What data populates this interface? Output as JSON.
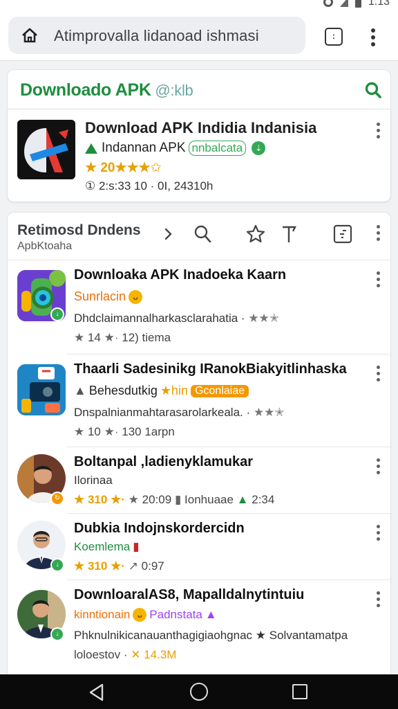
{
  "status": {
    "time": "1:13"
  },
  "browser": {
    "url": "Atimprovalla lidanoad ishmasi",
    "tabs_count": ":"
  },
  "search": {
    "title": "Downloado APK",
    "title_suffix": " @:klb"
  },
  "featured": {
    "title": "Download APK Indidia Indanisia",
    "developer": "Indannan APK",
    "developer_badge": "nnbalcata",
    "rating_text": "20",
    "stars": "★★★",
    "empty_star": "✩",
    "meta": "2:s:33 10 · 0I, 24310h"
  },
  "list": {
    "header_title": "Retimosd Dndens",
    "header_sub": "ApbKtoaha",
    "items": [
      {
        "title": "Downloaka APK Inadoeka Kaarn",
        "tag": "Sunrlacin",
        "tag_color": "#e8710a",
        "desc": "Dhdclaimannalharkasclarahatia ·",
        "desc_stars": "★★✭",
        "rating": "14",
        "meta": "12) tiema"
      },
      {
        "title": "Thaarli Sadesinikg IRanokBiakyitlinhaska",
        "tag": "Behesdutkig",
        "tag_extra": "★hin",
        "tag_pill": "Gconlaiae",
        "desc": "Dnspalnianmahtarasarolarkeala. ·",
        "desc_stars": "★★✭",
        "rating": "10",
        "meta": "130 1arpn"
      },
      {
        "title": "Boltanpal ,ladienyklamukar",
        "tag": "Ilorinaa",
        "rating": "310",
        "meta": "20:09",
        "meta2": "Ionhuaae",
        "meta3": "2:34"
      },
      {
        "title": "Dubkia Indojnskordercidn",
        "tag": "Koemlema",
        "tag_color": "#1e8e3e",
        "rating": "310",
        "meta": "0:97"
      },
      {
        "title": "DownloaralAS8, Mapalldalnytintuiu",
        "tag": "kinntionain",
        "tag_color": "#e8710a",
        "tag_extra": "Padnstata",
        "tag_extra_color": "#a142f4",
        "desc": "Phknulnikicanauanthagigiaohgnac",
        "desc_tail": "★ Solvantamatpa",
        "meta": "loloestov ·",
        "meta_tail": "✕ 14.3M"
      }
    ]
  },
  "colors": {
    "accent": "#1e8e3e",
    "star": "#e8a000",
    "nav": "#0a0a0a"
  }
}
